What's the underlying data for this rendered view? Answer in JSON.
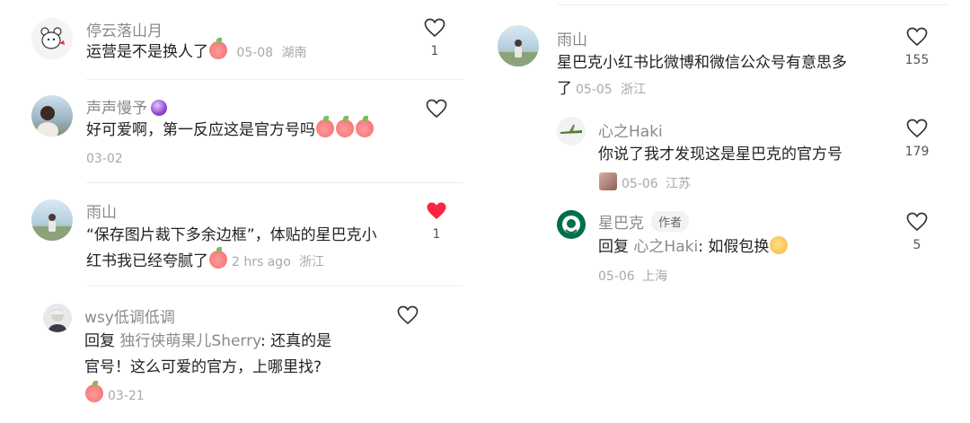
{
  "left": {
    "comments": [
      {
        "user": "停云落山月",
        "text": "运营是不是换人了",
        "emojis": [
          "peach"
        ],
        "date": "05-08",
        "location": "湖南",
        "likes": "1",
        "liked": false
      },
      {
        "user": "声声慢予",
        "badge": "crystal-ball-icon",
        "text": "好可爱啊，第一反应这是官方号吗",
        "emojis": [
          "peach",
          "peach",
          "peach"
        ],
        "date": "03-02",
        "likes": "",
        "liked": false
      },
      {
        "user": "雨山",
        "text_line1": "“保存图片裁下多余边框”，体贴的星巴克小",
        "text_line2": "红书我已经夸腻了",
        "emojis": [
          "peach"
        ],
        "date": "2 hrs ago",
        "location": "浙江",
        "likes": "1",
        "liked": true
      },
      {
        "user": "wsy低调低调",
        "reply_prefix": "回复",
        "reply_target": "独行侠萌果儿Sherry",
        "text_line1": ": 还真的是",
        "text_line2": "官号！这么可爱的官方，上哪里找?",
        "emojis": [
          "peach"
        ],
        "date": "03-21",
        "likes": "",
        "liked": false
      }
    ]
  },
  "right": {
    "comments": [
      {
        "user": "雨山",
        "text_line1": "星巴克小红书比微博和微信公众号有意思多",
        "text_line2": "了",
        "date": "05-05",
        "location": "浙江",
        "likes": "155",
        "liked": false
      },
      {
        "user": "心之Haki",
        "text": "你说了我才发现这是星巴克的官方号",
        "emojis": [
          "sticker"
        ],
        "date": "05-06",
        "location": "江苏",
        "likes": "179",
        "liked": false
      },
      {
        "user": "星巴克",
        "author_tag": "作者",
        "reply_prefix": "回复",
        "reply_target": "心之Haki",
        "text_tail": ": 如假包换",
        "emojis": [
          "face"
        ],
        "date": "05-06",
        "location": "上海",
        "likes": "5",
        "liked": false
      }
    ]
  },
  "colors": {
    "username": "#8a8a8a",
    "text": "#222222",
    "meta": "#a8a8a8",
    "liked_heart": "#ff2442",
    "starbucks_green": "#00704a"
  }
}
